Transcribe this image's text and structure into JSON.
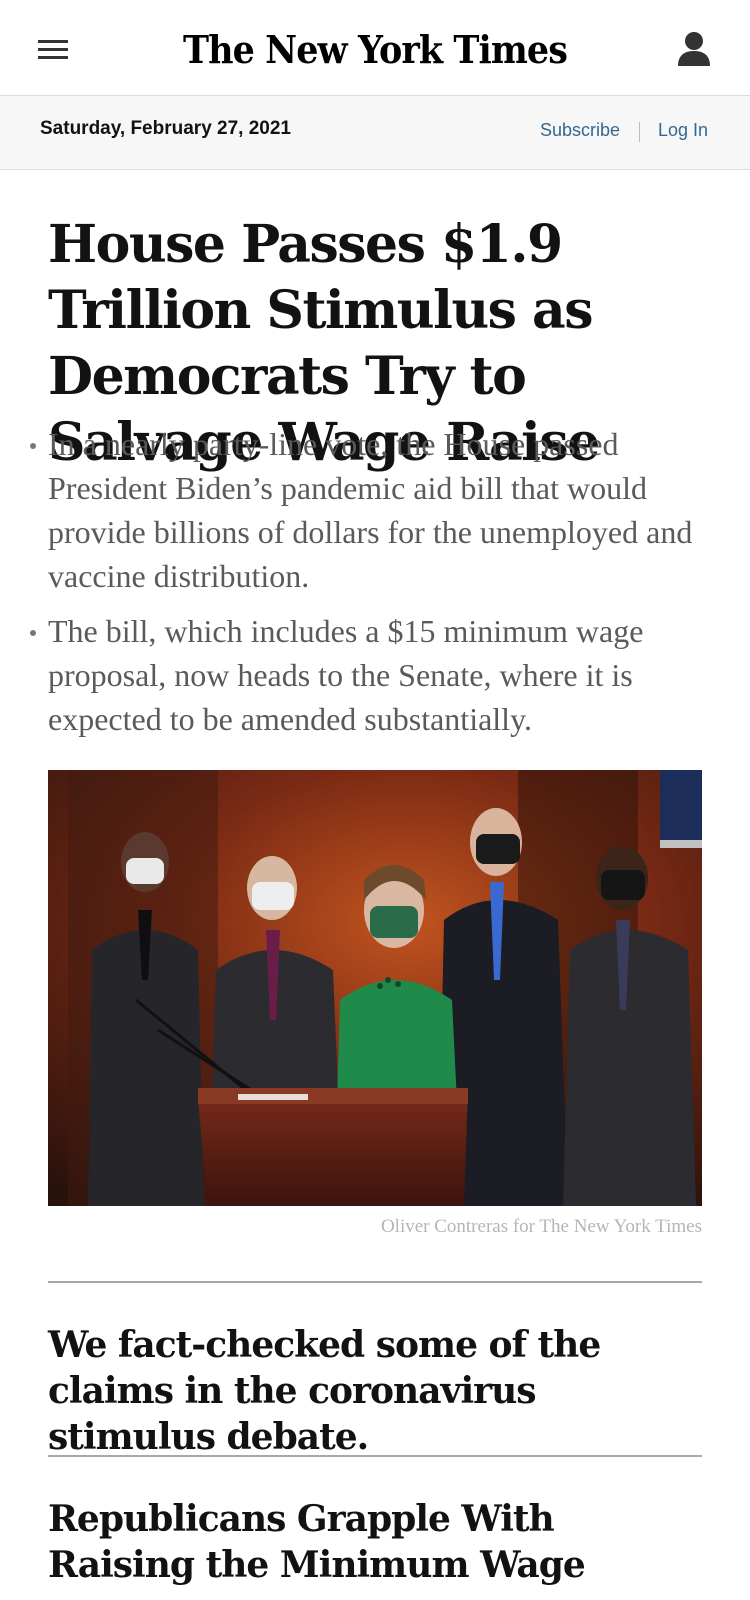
{
  "masthead": {
    "logo_text": "The New York Times",
    "menu_icon": "hamburger-menu-icon",
    "account_icon": "user-account-icon"
  },
  "datebar": {
    "date": "Saturday, February 27, 2021",
    "subscribe_label": "Subscribe",
    "login_label": "Log In",
    "link_color": "#326891"
  },
  "lead_story": {
    "headline": "House Passes $1.9 Trillion Stimulus as Democrats Try to Salvage Wage Raise",
    "summary": [
      "In a nearly party-line vote, the House passed President Biden’s pandemic aid bill that would provide billions of dollars for the unemployed and vaccine distribution.",
      "The bill, which includes a $15 minimum wage proposal, now heads to the Senate, where it is expected to be amended substantially."
    ],
    "photo_credit": "Oliver Contreras for The New York Times"
  },
  "stories": [
    {
      "headline": "We fact-checked some of the claims in the coronavirus stimulus debate."
    },
    {
      "headline": "Republicans Grapple With Raising the Minimum Wage"
    }
  ]
}
